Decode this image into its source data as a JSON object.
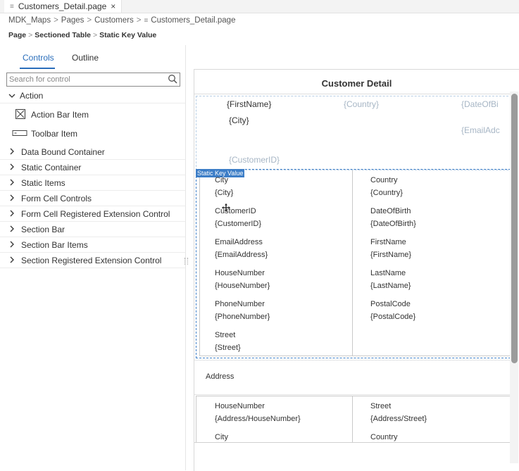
{
  "tab": {
    "filename": "Customers_Detail.page",
    "file_icon": "file-lines-icon",
    "close": "×"
  },
  "breadcrumb": {
    "items": [
      "MDK_Maps",
      "Pages",
      "Customers",
      "Customers_Detail.page"
    ],
    "separator": ">"
  },
  "designer_breadcrumb": {
    "items": [
      "Page",
      "Sectioned Table",
      "Static Key Value"
    ],
    "separator": ">"
  },
  "panel": {
    "tabs": [
      {
        "label": "Controls"
      },
      {
        "label": "Outline"
      }
    ],
    "search_placeholder": "Search for control",
    "expanded_group": "Action",
    "action_items": [
      "Action Bar Item",
      "Toolbar Item"
    ],
    "groups": [
      "Data Bound Container",
      "Static Container",
      "Static Items",
      "Form Cell Controls",
      "Form Cell Registered Extension Control",
      "Section Bar",
      "Section Bar Items",
      "Section Registered Extension Control"
    ]
  },
  "canvas": {
    "title": "Customer Detail",
    "header": {
      "first_name": "{FirstName}",
      "country": "{Country}",
      "date_of_birth": "{DateOfBi",
      "city": "{City}",
      "email": "{EmailAdc",
      "customer_id": "{CustomerID}"
    },
    "skv_tag": "Static Key Value",
    "skv_left": [
      {
        "key": "City",
        "value": "{City}"
      },
      {
        "key": "CustomerID",
        "value": "{CustomerID}"
      },
      {
        "key": "EmailAddress",
        "value": "{EmailAddress}"
      },
      {
        "key": "HouseNumber",
        "value": "{HouseNumber}"
      },
      {
        "key": "PhoneNumber",
        "value": "{PhoneNumber}"
      },
      {
        "key": "Street",
        "value": "{Street}"
      }
    ],
    "skv_right": [
      {
        "key": "Country",
        "value": "{Country}"
      },
      {
        "key": "DateOfBirth",
        "value": "{DateOfBirth}"
      },
      {
        "key": "FirstName",
        "value": "{FirstName}"
      },
      {
        "key": "LastName",
        "value": "{LastName}"
      },
      {
        "key": "PostalCode",
        "value": "{PostalCode}"
      }
    ],
    "address_label": "Address",
    "address_left": [
      {
        "key": "HouseNumber",
        "value": "{Address/HouseNumber}"
      },
      {
        "key": "City"
      }
    ],
    "address_right": [
      {
        "key": "Street",
        "value": "{Address/Street}"
      },
      {
        "key": "Country"
      }
    ]
  },
  "colors": {
    "accent": "#2a6ebb",
    "selection": "#3d7ec7",
    "placeholder_light": "#a7b6c5"
  }
}
